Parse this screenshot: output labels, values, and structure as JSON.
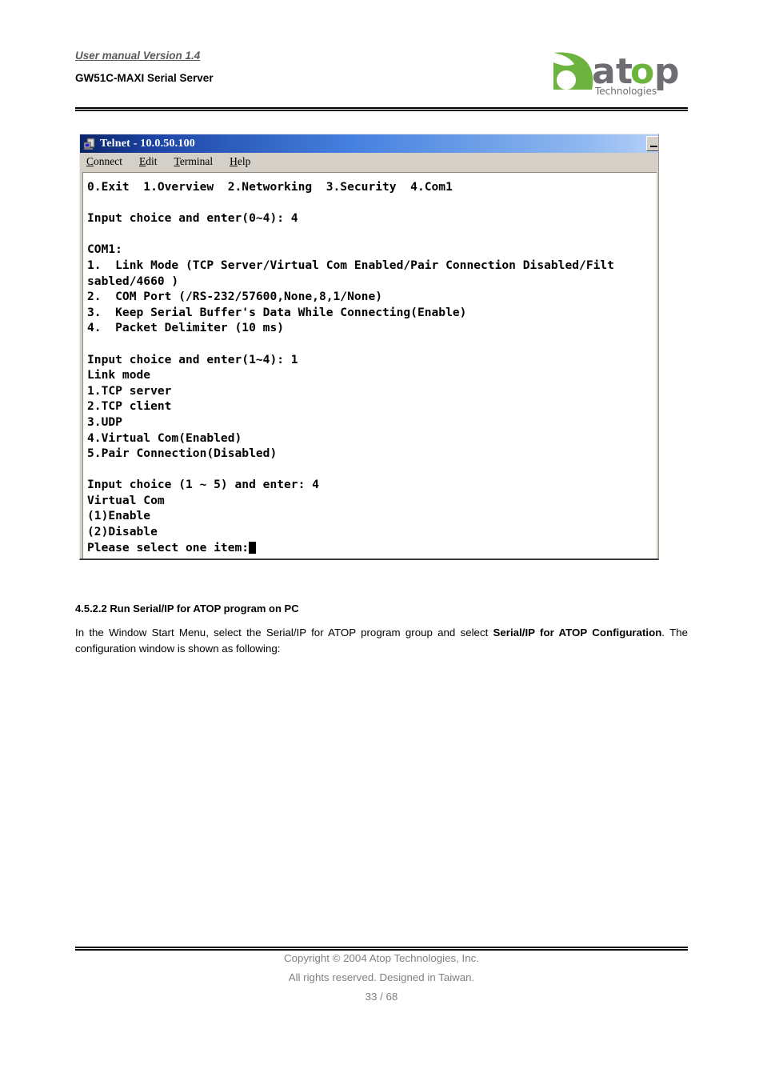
{
  "header": {
    "version": "User manual Version 1.4",
    "title": "GW51C-MAXI Serial Server",
    "logo": {
      "wordmark": "atop",
      "tagline": "Technologies",
      "green": "#6cb33f",
      "gray": "#6d6e71"
    }
  },
  "telnet": {
    "title": "Telnet - 10.0.50.100",
    "icon": "computer-icon",
    "window_buttons": [
      {
        "name": "minimize-button",
        "glyph": "minimize"
      }
    ],
    "menu": [
      {
        "accel": "C",
        "rest": "onnect"
      },
      {
        "accel": "E",
        "rest": "dit"
      },
      {
        "accel": "T",
        "rest": "erminal"
      },
      {
        "accel": "H",
        "rest": "elp"
      }
    ],
    "lines": [
      "0.Exit  1.Overview  2.Networking  3.Security  4.Com1",
      "",
      "Input choice and enter(0~4): 4",
      "",
      "COM1:",
      "1.  Link Mode (TCP Server/Virtual Com Enabled/Pair Connection Disabled/Filt",
      "sabled/4660 )",
      "2.  COM Port (/RS-232/57600,None,8,1/None)",
      "3.  Keep Serial Buffer's Data While Connecting(Enable)",
      "4.  Packet Delimiter (10 ms)",
      "",
      "Input choice and enter(1~4): 1",
      "Link mode",
      "1.TCP server",
      "2.TCP client",
      "3.UDP",
      "4.Virtual Com(Enabled)",
      "5.Pair Connection(Disabled)",
      "",
      "Input choice (1 ~ 5) and enter: 4",
      "Virtual Com",
      "(1)Enable",
      "(2)Disable"
    ],
    "prompt_line": "Please select one item:"
  },
  "content": {
    "section_heading": "4.5.2.2 Run Serial/IP for ATOP program on PC",
    "paragraph": {
      "part1": "In the Window Start Menu, select the Serial/IP for ATOP program group and select ",
      "bold1": "Serial/IP for ATOP Configuration",
      "part2": ". The configuration window is shown as following:"
    }
  },
  "footer": {
    "copyright": "Copyright © 2004 Atop Technologies, Inc.",
    "rights": "All rights reserved. Designed in Taiwan.",
    "page": "33 / 68"
  }
}
